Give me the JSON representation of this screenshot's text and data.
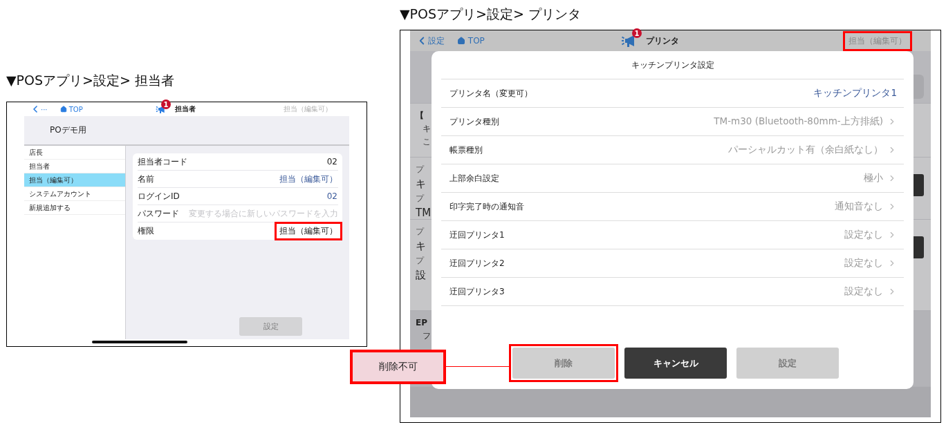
{
  "left_figure": {
    "heading": "▼POSアプリ>設定> 担当者",
    "header": {
      "back_label": "···",
      "top_label": "TOP",
      "badge": "1",
      "title": "担当者",
      "user": "担当（編集可）",
      "user_highlighted": false
    },
    "store_name": "POデモ用",
    "sidebar": [
      {
        "label": "店長",
        "selected": false
      },
      {
        "label": "担当者",
        "selected": false
      },
      {
        "label": "担当（編集可）",
        "selected": true
      },
      {
        "label": "システムアカウント",
        "selected": false
      },
      {
        "label": "新規追加する",
        "selected": false
      }
    ],
    "rows": [
      {
        "kind": "plain",
        "label": "担当者コード",
        "value": "02",
        "highlighted": false
      },
      {
        "kind": "link",
        "label": "名前",
        "value": "担当（編集可）",
        "highlighted": false
      },
      {
        "kind": "link",
        "label": "ログインID",
        "value": "02",
        "highlighted": false
      },
      {
        "kind": "input",
        "label": "パスワード",
        "placeholder": "変更する場合に新しいパスワードを入力"
      },
      {
        "kind": "plain",
        "label": "権限",
        "value": "担当（編集可）",
        "highlighted": true
      }
    ],
    "submit_button": {
      "label": "設定",
      "disabled": true
    }
  },
  "right_figure": {
    "heading": "▼POSアプリ>設定> プリンタ",
    "header": {
      "back_label": "設定",
      "top_label": "TOP",
      "badge": "1",
      "title": "プリンタ",
      "user": "担当（編集可）",
      "user_highlighted": true
    },
    "background": [
      {
        "kind": "band"
      },
      {
        "kind": "info",
        "title": "【",
        "lines": [
          "キ",
          "こ"
        ]
      },
      {
        "kind": "printer",
        "lines": [
          "プ",
          "キ",
          "プ",
          "TM"
        ]
      },
      {
        "kind": "printer",
        "lines": [
          "プ",
          "キ",
          "プ",
          "設"
        ]
      },
      {
        "kind": "section",
        "title": "EP",
        "lines": [
          "フ"
        ]
      }
    ],
    "modal": {
      "title": "キッチンプリンタ設定",
      "rows": [
        {
          "kind": "link",
          "label": "プリンタ名（変更可）",
          "value": "キッチンプリンタ1"
        },
        {
          "kind": "select",
          "label": "プリンタ種別",
          "value": "TM-m30 (Bluetooth-80mm-上方排紙)"
        },
        {
          "kind": "select",
          "label": "帳票種別",
          "value": "パーシャルカット有（余白紙なし）"
        },
        {
          "kind": "select",
          "label": "上部余白設定",
          "value": "極小"
        },
        {
          "kind": "select",
          "label": "印字完了時の通知音",
          "value": "通知音なし"
        },
        {
          "kind": "select",
          "label": "迂回プリンタ1",
          "value": "設定なし"
        },
        {
          "kind": "select",
          "label": "迂回プリンタ2",
          "value": "設定なし"
        },
        {
          "kind": "select",
          "label": "迂回プリンタ3",
          "value": "設定なし"
        }
      ],
      "buttons": [
        {
          "kind": "disabled",
          "label": "削除",
          "highlighted": true
        },
        {
          "kind": "dark",
          "label": "キャンセル",
          "highlighted": false
        },
        {
          "kind": "disabled",
          "label": "設定",
          "highlighted": false
        }
      ]
    },
    "callout": "削除不可"
  }
}
